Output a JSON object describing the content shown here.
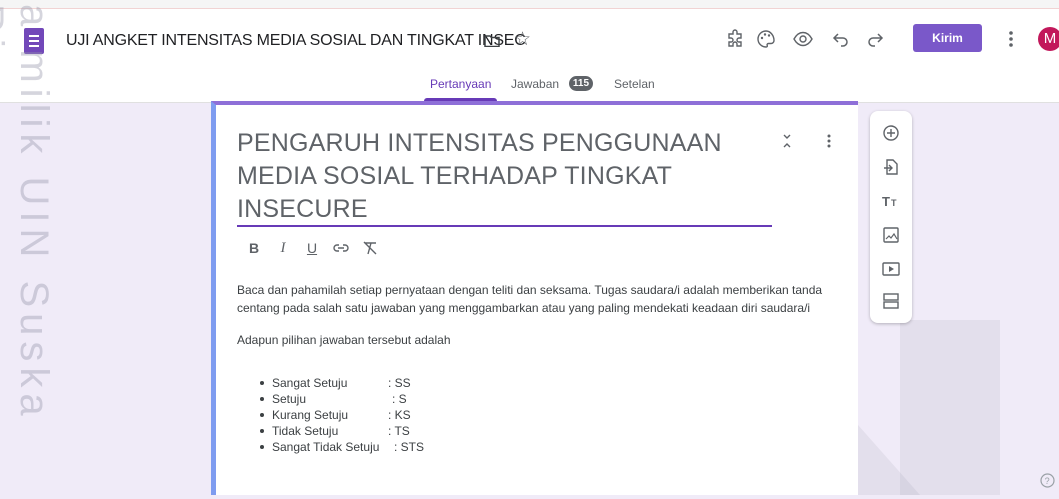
{
  "app": {
    "form_title": "UJI ANGKET INTENSITAS MEDIA SOSIAL DAN TINGKAT INSEC",
    "send_label": "Kirim",
    "avatar_letter": "M",
    "accent": "#673ab7",
    "send_color": "#7a58c9"
  },
  "toolbar_icons": [
    "addon-icon",
    "palette-icon",
    "preview-eye-icon",
    "undo-icon",
    "redo-icon",
    "more-vertical-icon"
  ],
  "tabs": [
    {
      "label": "Pertanyaan",
      "active": true
    },
    {
      "label": "Jawaban",
      "badge": "115"
    },
    {
      "label": "Setelan"
    }
  ],
  "form": {
    "title": "PENGARUH INTENSITAS PENGGUNAAN MEDIA SOSIAL TERHADAP TINGKAT INSECURE",
    "format_buttons": [
      "B",
      "I",
      "U",
      "link",
      "clear-format"
    ],
    "description_1": "Baca dan pahamilah setiap pernyataan dengan teliti dan seksama. Tugas saudara/i adalah memberikan tanda centang  pada salah satu jawaban yang menggambarkan atau yang paling mendekati keadaan diri saudara/i",
    "description_2": "Adapun pilihan jawaban tersebut adalah",
    "options": [
      {
        "label": "Sangat Setuju",
        "code": ": SS"
      },
      {
        "label": "Setuju",
        "code": ": S"
      },
      {
        "label": "Kurang Setuju",
        "code": ": KS"
      },
      {
        "label": "Tidak Setuju",
        "code": ": TS"
      },
      {
        "label": "Sangat Tidak Setuju",
        "code": ": STS"
      }
    ]
  },
  "side_toolbar": [
    "add-question-icon",
    "import-question-icon",
    "title-text-icon",
    "image-icon",
    "video-icon",
    "section-icon"
  ],
  "watermark": {
    "side_text": "a milik UIN Suska Riau"
  }
}
